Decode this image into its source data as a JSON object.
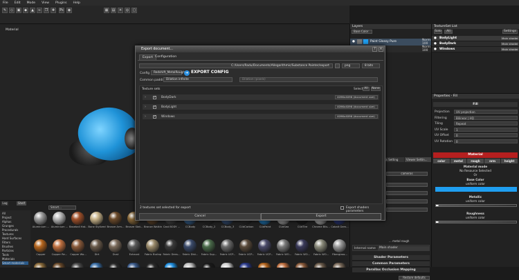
{
  "menubar": [
    "File",
    "Edit",
    "Mode",
    "View",
    "Plugins",
    "Help"
  ],
  "viewport": {
    "label": "Material"
  },
  "layers": {
    "title": "Layers",
    "channel": "Base Color",
    "layer_name": "Paint Glossy Pure",
    "blend": "Norm",
    "opacity": "100",
    "blend2": "Norm",
    "opacity2": "100"
  },
  "texture_set_list": {
    "title": "TextureSet List",
    "tab_solo": "Solo",
    "tab_all": "All",
    "settings": "Settings",
    "items": [
      {
        "name": "BodyLight",
        "shader": "Main shader"
      },
      {
        "name": "BodyDark",
        "shader": "Main shader"
      },
      {
        "name": "Windows",
        "shader": "Main shader"
      }
    ]
  },
  "properties": {
    "title": "Properties - Fill",
    "section_fill": "Fill",
    "rows": [
      {
        "label": "Projection",
        "value": "UV projection"
      },
      {
        "label": "Filtering",
        "value": "Bilinear | HQ"
      },
      {
        "label": "Tiling",
        "value": "Repeat"
      },
      {
        "label": "UV Scale",
        "value": "1"
      },
      {
        "label": "UV Offset",
        "value": "0"
      },
      {
        "label": "UV Rotation",
        "value": "0"
      }
    ],
    "material_label": "Material",
    "channels": [
      "color",
      "metal",
      "rough",
      "nrm",
      "height"
    ],
    "material_mode": "Material mode",
    "no_resource": "No Resource Selected",
    "or": "Or",
    "base_color": "Base Color",
    "base_color_sub": "uniform color",
    "base_color_hex": "#1f9ef0",
    "metallic": "Metallic",
    "metallic_sub": "uniform color",
    "metallic_level": 0.03,
    "roughness": "Roughness",
    "roughness_sub": "uniform color",
    "roughness_level": 0.03
  },
  "shelf": {
    "tabs": [
      "Log",
      "Shelf"
    ],
    "search": "Smart...",
    "categories": [
      "All",
      "Project",
      "Alphas",
      "Grunges",
      "Procedurals",
      "Textures",
      "Hard Surfaces",
      "Filters",
      "Brushes",
      "Particles",
      "Tools",
      "Materials",
      "Smart materials"
    ],
    "row1": [
      "Aluminium ...",
      "Aluminium ...",
      "Baseball Hat...",
      "Bone Stylized",
      "Bronze Arm...",
      "Bronze Stat...",
      "Bronze Walking",
      "Cast BODY ...",
      "CCBody",
      "CCBody_2",
      "CCBody_3",
      "CUdCarbon",
      "CUdPaint",
      "CUdSea",
      "CUdTire",
      "Chrome Blis...",
      "Cobalt Gem..."
    ],
    "row2": [
      "Copper",
      "Copper Re...",
      "Copper Wo...",
      "Dirt",
      "Dust",
      "Exhaust",
      "Fabric Burlap",
      "Fabric Dens...",
      "Fabric Dist...",
      "Fabric Sup...",
      "Fabric UCP...",
      "Fabric UCP...",
      "Fabric UCP...",
      "Fabric WO...",
      "Fabric WO...",
      "Fabric WO...",
      "Fiberglass..."
    ]
  },
  "shader_panel": {
    "tab1": "...lnks Setting",
    "tab2": "Viewer Settin...",
    "cameras": "cameras",
    "internal_name_label": "Internal name",
    "internal_name": "Main shader",
    "shader_params": "Shader Parameters",
    "common_params": "Common Parameters",
    "parallax": "Parallax Occlusion Mapping",
    "restore": "Restore defaults",
    "small_text": "... metal rough"
  },
  "dialog": {
    "title": "Export document...",
    "tabs": [
      "Export",
      "Configuration"
    ],
    "path": "C:/Users/Radu/Documents/Allegorithmic/Substance Painter/export",
    "format": "png",
    "bits": "8 bits",
    "config_label": "Config",
    "config_value": "Redshift_MetalRough",
    "export_config_badge": "EXPORT CONFIG",
    "padding_label": "Common padding",
    "padding_value": "Dilation infinite",
    "dilation_placeholder": "Dilation (pixels)",
    "texture_sets_label": "Texture sets",
    "select_label": "Select",
    "all_btn": "All",
    "none_btn": "None",
    "sets": [
      {
        "name": "BodyDark",
        "res": "4096x4096 (document size)"
      },
      {
        "name": "BodyLight",
        "res": "4096x4096 (document size)"
      },
      {
        "name": "Windows",
        "res": "4096x4096 (document size)"
      }
    ],
    "status": "2 textures set selected for export",
    "export_shaders": "Export shaders parameters",
    "cancel": "Cancel",
    "export": "Export"
  }
}
